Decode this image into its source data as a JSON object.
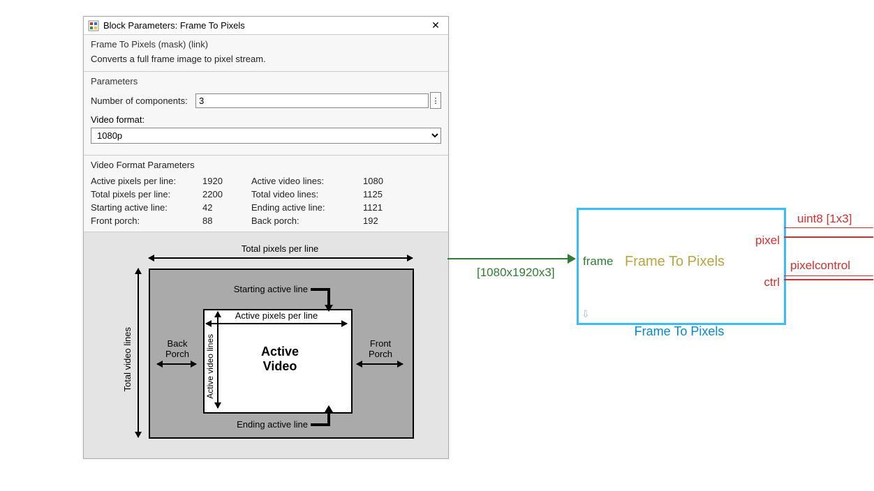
{
  "dialog": {
    "title": "Block Parameters: Frame To Pixels",
    "mask_title": "Frame To Pixels (mask) (link)",
    "mask_desc": "Converts a full frame image to pixel stream.",
    "parameters_header": "Parameters",
    "num_components_label": "Number of components:",
    "num_components_value": "3",
    "video_format_label": "Video format:",
    "video_format_value": "1080p",
    "vfp_header": "Video Format Parameters",
    "vfp": {
      "active_px_label": "Active pixels per line:",
      "active_px": "1920",
      "active_lines_label": "Active video lines:",
      "active_lines": "1080",
      "total_px_label": "Total pixels per line:",
      "total_px": "2200",
      "total_lines_label": "Total video lines:",
      "total_lines": "1125",
      "start_line_label": "Starting active line:",
      "start_line": "42",
      "end_line_label": "Ending active line:",
      "end_line": "1121",
      "front_porch_label": "Front porch:",
      "front_porch": "88",
      "back_porch_label": "Back porch:",
      "back_porch": "192"
    },
    "diagram": {
      "total_px": "Total pixels per line",
      "total_lines": "Total video lines",
      "start_line": "Starting active line",
      "end_line": "Ending active line",
      "active_px": "Active pixels per line",
      "active_lines": "Active video lines",
      "back_porch": "Back\nPorch",
      "front_porch": "Front\nPorch",
      "active_video": "Active\nVideo"
    }
  },
  "block": {
    "in_port": "frame",
    "title": "Frame To Pixels",
    "out_port1": "pixel",
    "out_port2": "ctrl",
    "name": "Frame To Pixels",
    "sig_in": "[1080x1920x3]",
    "sig_out1": "uint8 [1x3]",
    "sig_out2": "pixelcontrol"
  }
}
